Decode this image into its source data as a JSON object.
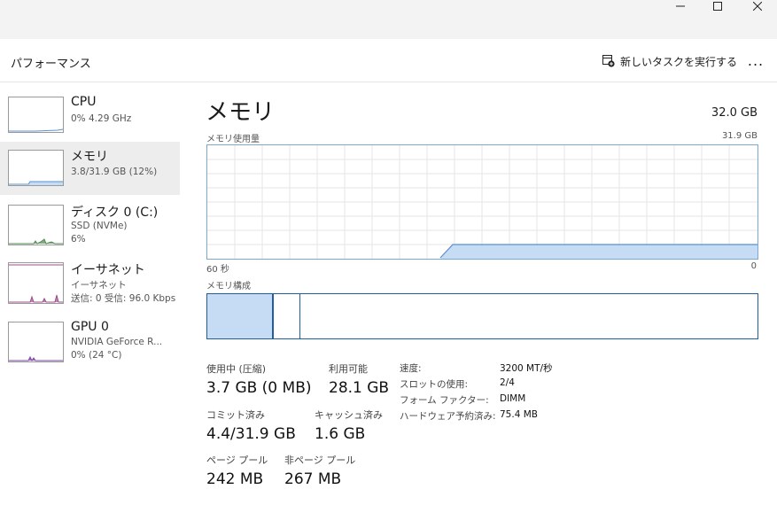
{
  "window": {
    "minimize_icon": "minimize-icon",
    "maximize_icon": "maximize-icon",
    "close_icon": "close-icon"
  },
  "header": {
    "title": "パフォーマンス",
    "run_task_label": "新しいタスクを実行する",
    "more_label": "..."
  },
  "sidebar": {
    "items": [
      {
        "name": "CPU",
        "sub1": "0%  4.29 GHz",
        "sub2": "",
        "sub3": ""
      },
      {
        "name": "メモリ",
        "sub1": "3.8/31.9 GB (12%)",
        "sub2": "",
        "sub3": "",
        "selected": true
      },
      {
        "name": "ディスク 0 (C:)",
        "sub1": "SSD (NVMe)",
        "sub2": "6%",
        "sub3": ""
      },
      {
        "name": "イーサネット",
        "sub1": "イーサネット",
        "sub2": "送信: 0 受信: 96.0 Kbps",
        "sub3": ""
      },
      {
        "name": "GPU 0",
        "sub1": "NVIDIA GeForce R...",
        "sub2": "0%  (24 °C)",
        "sub3": ""
      }
    ]
  },
  "main": {
    "title": "メモリ",
    "total": "32.0 GB",
    "usage_label": "メモリ使用量",
    "usage_max": "31.9 GB",
    "axis_left": "60 秒",
    "axis_right": "0",
    "composition_label": "メモリ構成",
    "stats": {
      "in_use_label": "使用中 (圧縮)",
      "in_use_value": "3.7 GB (0 MB)",
      "available_label": "利用可能",
      "available_value": "28.1 GB",
      "committed_label": "コミット済み",
      "committed_value": "4.4/31.9 GB",
      "cached_label": "キャッシュ済み",
      "cached_value": "1.6 GB",
      "paged_label": "ページ プール",
      "paged_value": "242 MB",
      "nonpaged_label": "非ページ プール",
      "nonpaged_value": "267 MB"
    },
    "details": [
      {
        "label": "速度:",
        "value": "3200 MT/秒"
      },
      {
        "label": "スロットの使用:",
        "value": "2/4"
      },
      {
        "label": "フォーム ファクター:",
        "value": "DIMM"
      },
      {
        "label": "ハードウェア予約済み:",
        "value": "75.4 MB"
      }
    ]
  },
  "colors": {
    "accent": "#1d5fa1",
    "graph_fill": "#c6dcf4",
    "graph_line": "#5b8fd0",
    "grid": "#e5e5e5"
  }
}
